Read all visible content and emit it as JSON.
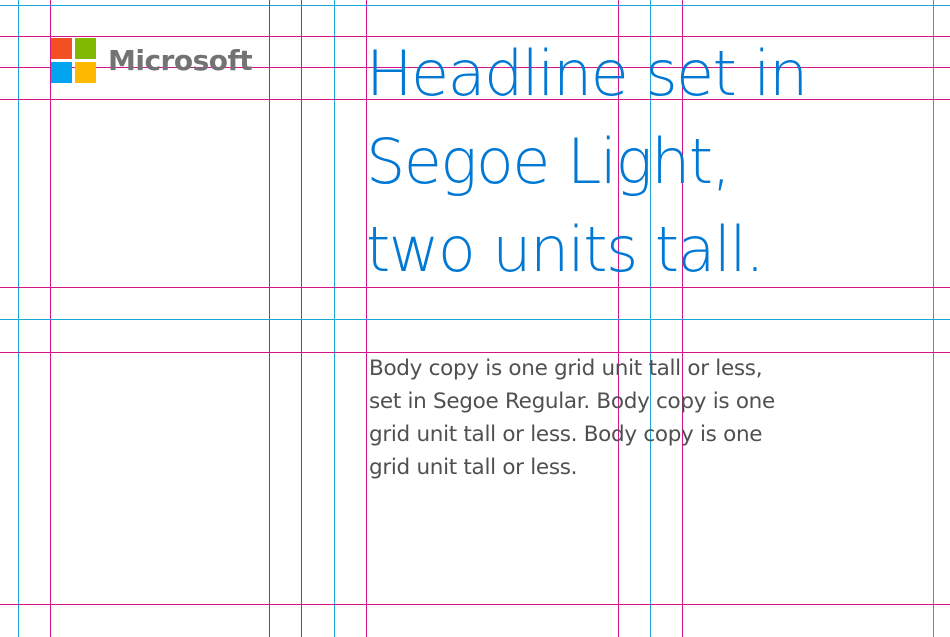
{
  "brand": {
    "wordmark": "Microsoft",
    "wordmark_color": "#737373",
    "logo_colors": {
      "top_left": "#f25022",
      "top_right": "#7fba00",
      "bottom_left": "#00a4ef",
      "bottom_right": "#ffb900"
    }
  },
  "headline": {
    "lines": [
      "Headline set in",
      "Segoe Light,",
      "two units tall."
    ],
    "color": "#0078d4"
  },
  "body_copy": {
    "lines": [
      "Body copy is one grid unit tall or less,",
      "set in Segoe Regular. Body copy is one",
      "grid unit tall or less. Body copy is one",
      "grid unit tall or less."
    ],
    "color": "#505050"
  },
  "grid": {
    "margin_line_color": "#d4148c",
    "column_line_color": "#1aa6d4"
  }
}
